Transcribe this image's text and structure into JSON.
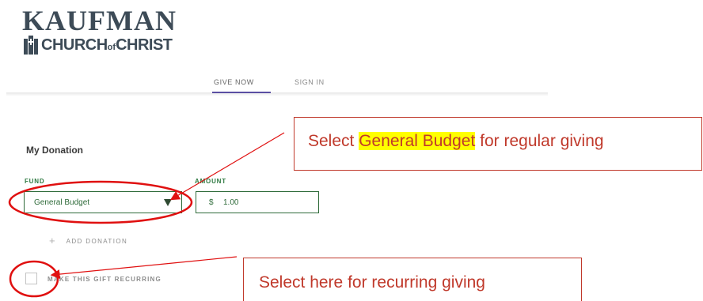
{
  "logo": {
    "top_text": "KAUFMAN",
    "bottom_text_1": "CHURCH",
    "bottom_text_of": "of",
    "bottom_text_2": "CHRIST",
    "icon": "church-icon"
  },
  "nav": {
    "tabs": [
      {
        "label": "GIVE NOW",
        "active": true
      },
      {
        "label": "SIGN IN",
        "active": false
      }
    ],
    "active_color": "#5b4fa3"
  },
  "form": {
    "heading": "My Donation",
    "fund_label": "FUND",
    "amount_label": "AMOUNT",
    "fund_value": "General Budget",
    "currency": "$",
    "amount_value": "1.00",
    "add_icon": "plus-icon",
    "add_label": "ADD DONATION",
    "recurring_label": "MAKE THIS GIFT RECURRING",
    "recurring_checked": false,
    "accent_color": "#2f6b3a"
  },
  "annotations": {
    "callout_1_before": "Select ",
    "callout_1_highlight": "General Budget",
    "callout_1_after": " for regular giving",
    "callout_2": "Select here for recurring giving",
    "color": "#e01010",
    "highlight_color": "#ffff00"
  }
}
